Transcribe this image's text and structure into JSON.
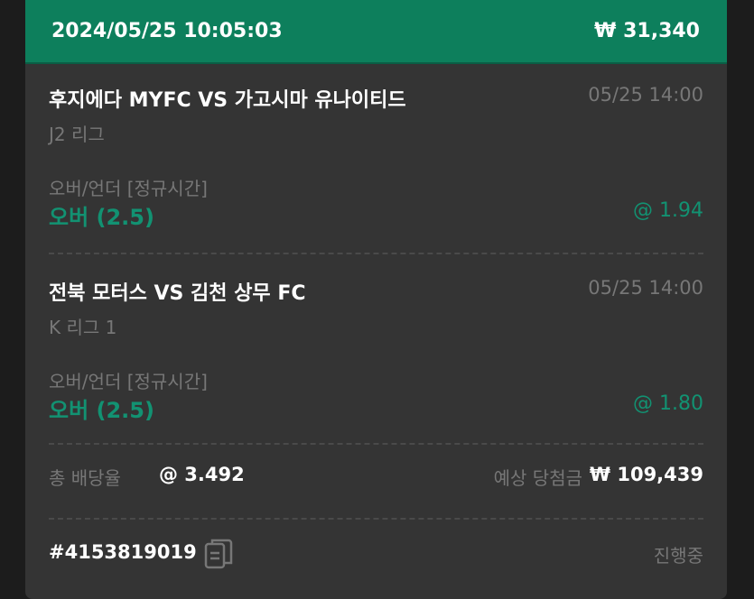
{
  "header": {
    "datetime": "2024/05/25 10:05:03",
    "stake": "₩ 31,340"
  },
  "bets": [
    {
      "match": "후지에다 MYFC VS 가고시마 유나이티드",
      "time": "05/25 14:00",
      "league": "J2 리그",
      "market": "오버/언더 [정규시간]",
      "pick": "오버 (2.5)",
      "odds": "@ 1.94"
    },
    {
      "match": "전북 모터스 VS 김천 상무 FC",
      "time": "05/25 14:00",
      "league": "K 리그 1",
      "market": "오버/언더 [정규시간]",
      "pick": "오버 (2.5)",
      "odds": "@ 1.80"
    }
  ],
  "summary": {
    "total_odds_label": "총 배당율",
    "total_odds": "@ 3.492",
    "payout_label": "예상 당첨금",
    "payout": "₩ 109,439"
  },
  "footer": {
    "ticket_id": "#4153819019",
    "copy_icon": "copy-icon",
    "status": "진행중"
  },
  "colors": {
    "header_bg": "#0d7f5c",
    "card_bg": "#343434",
    "accent": "#129272",
    "muted": "#777777"
  }
}
